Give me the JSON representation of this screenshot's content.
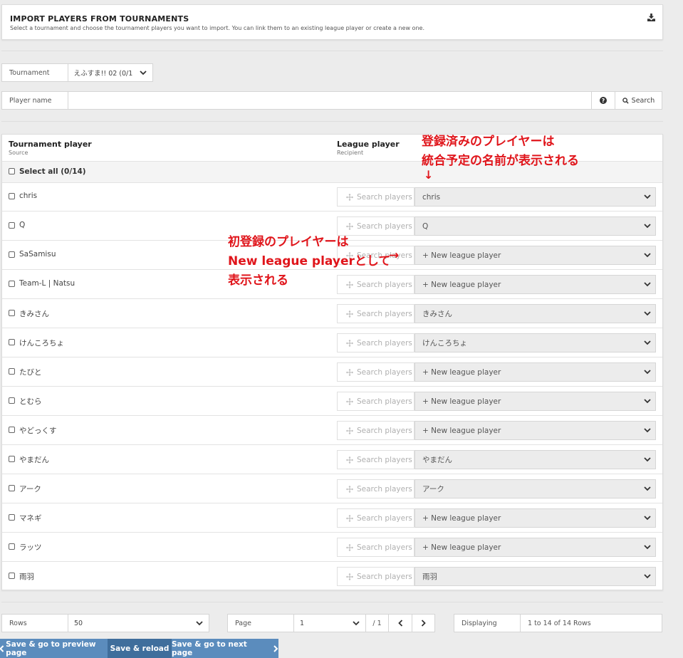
{
  "header": {
    "title": "IMPORT PLAYERS FROM TOURNAMENTS",
    "subtitle": "Select a tournament and choose the tournament players you want to import. You can link them to an existing league player or create a new one."
  },
  "tournament": {
    "label": "Tournament",
    "value": "えふすま!! 02 (0/1"
  },
  "player_search": {
    "label": "Player name",
    "value": "",
    "help": "?",
    "button": "Search"
  },
  "table": {
    "col1_title": "Tournament player",
    "col1_sub": "Source",
    "col2_title": "League player",
    "col2_sub": "Recipient",
    "select_all": "Select all (0/14)",
    "search_label": "Search players",
    "rows": [
      {
        "name": "chris",
        "recipient": "chris"
      },
      {
        "name": "Q",
        "recipient": "Q"
      },
      {
        "name": "SaSamisu",
        "recipient": "+ New league player"
      },
      {
        "name": "Team-L | Natsu",
        "recipient": "+ New league player"
      },
      {
        "name": "きみさん",
        "recipient": "きみさん"
      },
      {
        "name": "けんころちょ",
        "recipient": "けんころちょ"
      },
      {
        "name": "たびと",
        "recipient": "+ New league player"
      },
      {
        "name": "とむら",
        "recipient": "+ New league player"
      },
      {
        "name": "やどっくす",
        "recipient": "+ New league player"
      },
      {
        "name": "やまだん",
        "recipient": "やまだん"
      },
      {
        "name": "アーク",
        "recipient": "アーク"
      },
      {
        "name": "マネギ",
        "recipient": "+ New league player"
      },
      {
        "name": "ラッツ",
        "recipient": "+ New league player"
      },
      {
        "name": "雨羽",
        "recipient": "雨羽"
      }
    ]
  },
  "annotations": {
    "top_line1": "登録済みのプレイヤーは",
    "top_line2": "統合予定の名前が表示される",
    "top_arrow": "↓",
    "mid_line1": "初登録のプレイヤーは",
    "mid_line2": "New league playerとして",
    "mid_line3": "表示される",
    "mid_arrow": "→"
  },
  "footer": {
    "rows_label": "Rows",
    "rows_value": "50",
    "page_label": "Page",
    "page_value": "1",
    "page_total": "/ 1",
    "displaying_label": "Displaying",
    "displaying_value": "1 to 14 of 14 Rows"
  },
  "buttons": {
    "preview": "Save & go to preview page",
    "reload": "Save & reload",
    "next": "Save & go to next page"
  },
  "colors": {
    "accent_dark": "#3f6e9c",
    "accent_light": "#5b8cbd",
    "annotation": "#e0151b"
  }
}
